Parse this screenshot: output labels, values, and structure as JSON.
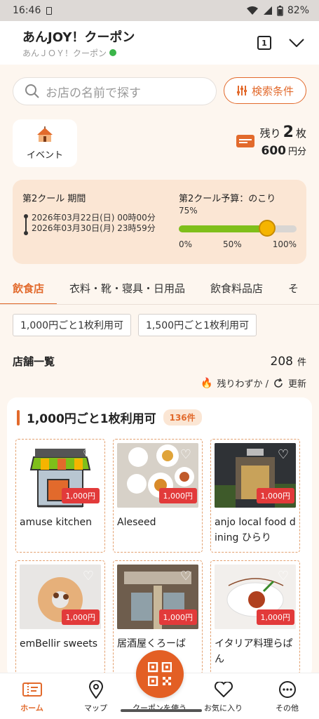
{
  "statusbar": {
    "time": "16:46",
    "battery": "82%"
  },
  "appbar": {
    "title": "あんJOY！クーポン",
    "subtitle": "あんＪＯＹ！クーポン",
    "tab_count": "1"
  },
  "search": {
    "placeholder": "お店の名前で探す",
    "filter_label": "検索条件"
  },
  "event": {
    "label": "イベント"
  },
  "tickets": {
    "remaining_prefix": "残り",
    "remaining_count": "2",
    "remaining_unit": "枚",
    "amount": "600",
    "amount_unit": "円分"
  },
  "period": {
    "label": "第2クール 期間",
    "start": "2026年03月22日(日) 00時00分",
    "end": "2026年03月30日(月) 23時59分",
    "budget_label": "第2クール予算：のこり",
    "budget_percent_label": "75%",
    "budget_remaining_fraction": 0.75,
    "scale": [
      "0%",
      "50%",
      "100%"
    ]
  },
  "tabs": [
    "飲食店",
    "衣料・靴・寝具・日用品",
    "飲食料品店",
    "そ"
  ],
  "chips": [
    "1,000円ごと1枚利用可",
    "1,500円ごと1枚利用可"
  ],
  "list": {
    "title": "店舗一覧",
    "count": "208",
    "count_unit": "件",
    "few_label": "残りわずか /",
    "refresh_label": "更新"
  },
  "section": {
    "title": "1,000円ごと1枚利用可",
    "badge": "136件"
  },
  "shops": [
    {
      "name": "amuse kitchen",
      "price": "1,000円"
    },
    {
      "name": "Aleseed",
      "price": "1,000円"
    },
    {
      "name": "anjo local food dining ひらり",
      "price": "1,000円"
    },
    {
      "name": "emBellir sweets",
      "price": "1,000円"
    },
    {
      "name": "居酒屋くろーば",
      "price": "1,000円"
    },
    {
      "name": "イタリア料理らぱん",
      "price": "1,000円"
    }
  ],
  "nav": [
    "ホーム",
    "マップ",
    "クーポンを使う",
    "お気に入り",
    "その他"
  ],
  "colors": {
    "accent": "#e26a2c",
    "price_red": "#e23a3a",
    "progress_green": "#7fbf1a"
  }
}
